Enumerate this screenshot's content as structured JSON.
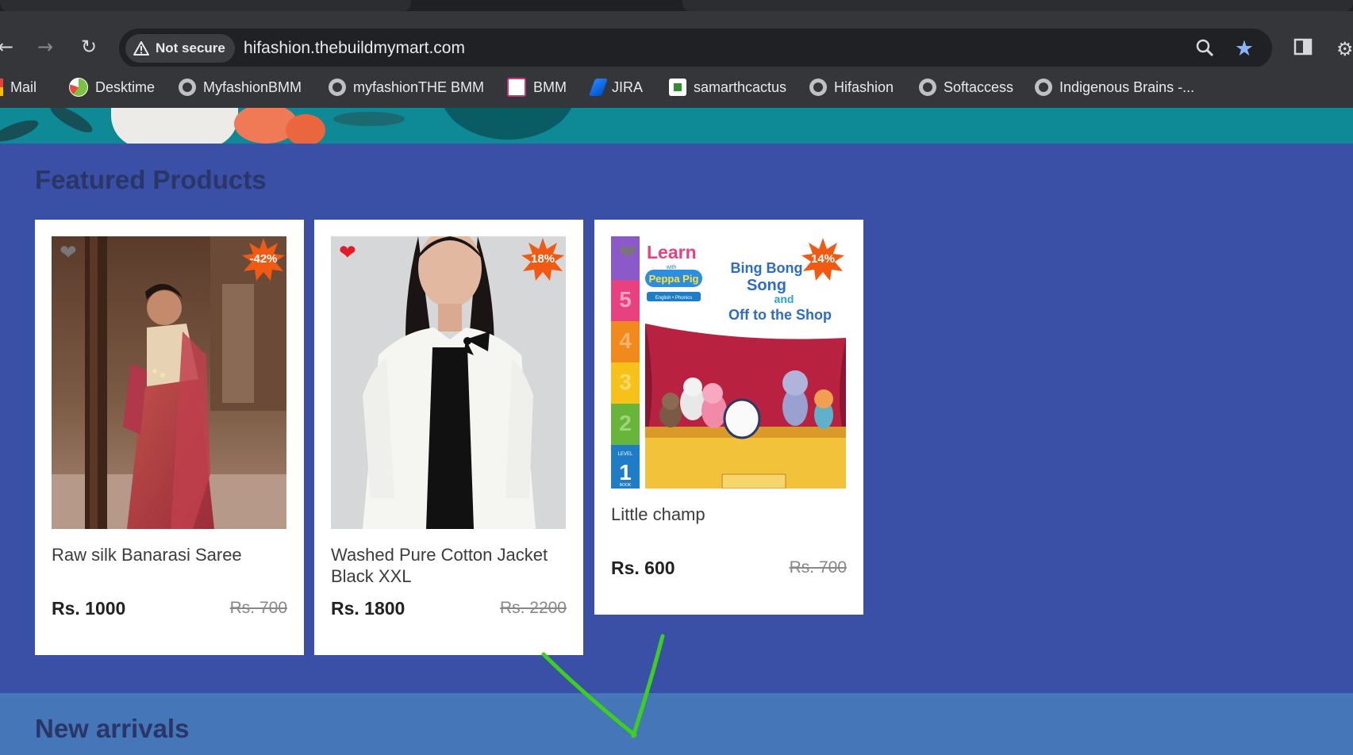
{
  "browser": {
    "security_label": "Not secure",
    "url": "hifashion.thebuildmymart.com",
    "bookmarks": [
      {
        "label": "Mail",
        "icon": "gmail-icon"
      },
      {
        "label": "Desktime",
        "icon": "desktime-icon"
      },
      {
        "label": "MyfashionBMM",
        "icon": "globe-icon"
      },
      {
        "label": "myfashionTHE BMM",
        "icon": "globe-icon"
      },
      {
        "label": "BMM",
        "icon": "bmm-icon"
      },
      {
        "label": "JIRA",
        "icon": "jira-icon"
      },
      {
        "label": "samarthcactus",
        "icon": "cactus-icon"
      },
      {
        "label": "Hifashion",
        "icon": "globe-icon"
      },
      {
        "label": "Softaccess",
        "icon": "globe-icon"
      },
      {
        "label": "Indigenous Brains -...",
        "icon": "globe-icon"
      }
    ]
  },
  "featured": {
    "title": "Featured Products",
    "products": [
      {
        "name": "Raw silk Banarasi Saree",
        "price": "Rs. 1000",
        "old_price": "Rs. 700",
        "discount": "-42%",
        "wishlisted": false
      },
      {
        "name": "Washed Pure Cotton Jacket Black XXL",
        "price": "Rs. 1800",
        "old_price": "Rs. 2200",
        "discount": "18%",
        "wishlisted": true
      },
      {
        "name": "Little champ",
        "price": "Rs. 600",
        "old_price": "Rs. 700",
        "discount": "14%",
        "wishlisted": false
      }
    ]
  },
  "book_cover": {
    "learn": "Learn",
    "with": "with",
    "series": "Peppa Pig",
    "sub": "English • Phonics",
    "line1": "Bing Bong",
    "line2": "Song",
    "line3": "and",
    "line4": "Off to the Shop",
    "levels": [
      "5",
      "4",
      "3",
      "2",
      "1"
    ],
    "level_label": "LEVEL",
    "book_label": "BOOK"
  },
  "arrivals": {
    "title": "New arrivals"
  },
  "colors": {
    "page_bg": "#3a4fa6",
    "arrivals_bg": "#4576b8",
    "badge": "#f05a12",
    "heart_active": "#e31b23",
    "heart_inactive": "#777777",
    "annotation_arrow": "#3ccf1e"
  }
}
